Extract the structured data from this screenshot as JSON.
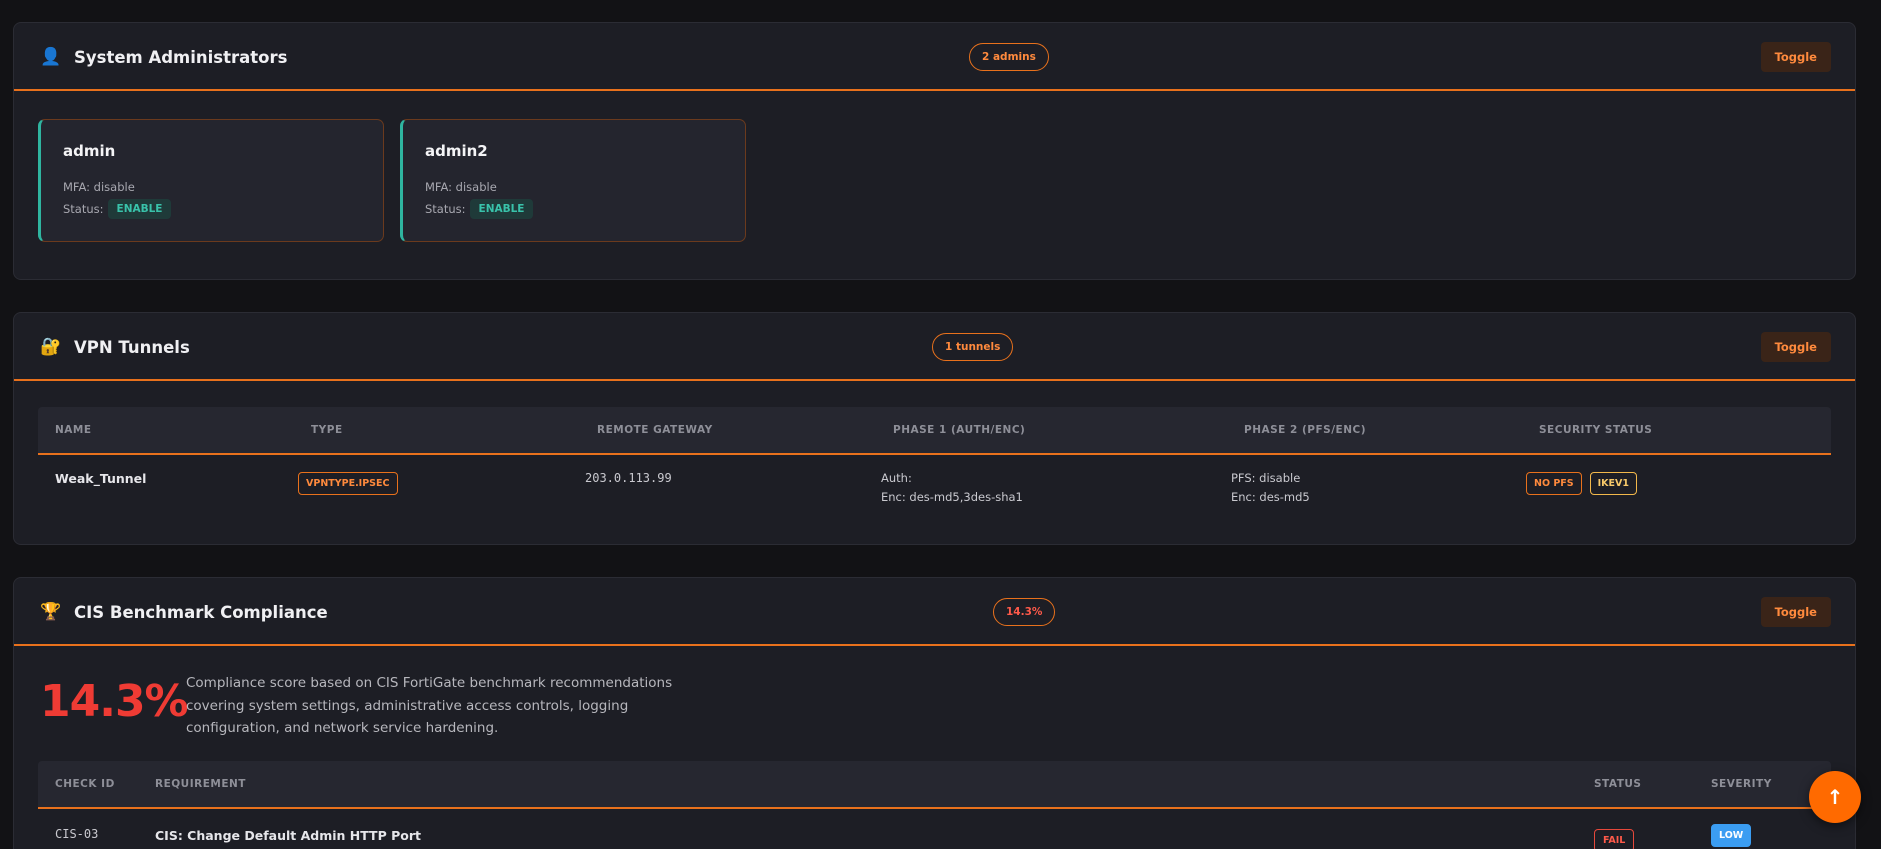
{
  "admins_section": {
    "icon": "person-icon",
    "icon_glyph": "👤",
    "title": "System Administrators",
    "count_badge": "2 admins",
    "toggle_label": "Toggle",
    "admins": [
      {
        "name": "admin",
        "mfa_label": "MFA: disable",
        "status_label": "Status:",
        "status": "ENABLE"
      },
      {
        "name": "admin2",
        "mfa_label": "MFA: disable",
        "status_label": "Status:",
        "status": "ENABLE"
      }
    ]
  },
  "vpn_section": {
    "icon": "lock-key-icon",
    "icon_glyph": "🔐",
    "title": "VPN Tunnels",
    "count_badge": "1 tunnels",
    "toggle_label": "Toggle",
    "columns": [
      "NAME",
      "TYPE",
      "REMOTE GATEWAY",
      "PHASE 1 (AUTH/ENC)",
      "PHASE 2 (PFS/ENC)",
      "SECURITY STATUS"
    ],
    "rows": [
      {
        "name": "Weak_Tunnel",
        "type": "VPNTYPE.IPSEC",
        "remote_gateway": "203.0.113.99",
        "phase1_auth": "Auth:",
        "phase1_enc": "Enc: des-md5,3des-sha1",
        "phase2_pfs": "PFS: disable",
        "phase2_enc": "Enc: des-md5",
        "security_tags": [
          "NO PFS",
          "IKEV1"
        ]
      }
    ]
  },
  "cis_section": {
    "icon": "trophy-icon",
    "icon_glyph": "🏆",
    "title": "CIS Benchmark Compliance",
    "score_badge": "14.3%",
    "toggle_label": "Toggle",
    "score": "14.3%",
    "description": "Compliance score based on CIS FortiGate benchmark recommendations covering system settings, administrative access controls, logging configuration, and network service hardening.",
    "columns": [
      "CHECK ID",
      "REQUIREMENT",
      "STATUS",
      "SEVERITY"
    ],
    "rows": [
      {
        "check_id": "CIS-03",
        "requirement": "CIS: Change Default Admin HTTP Port",
        "status": "FAIL",
        "severity": "LOW"
      }
    ]
  },
  "scroll_top_button": {
    "icon": "arrow-up-icon",
    "glyph": "↑"
  },
  "colors": {
    "accent": "#e8711c",
    "teal": "#2fb5a0",
    "danger": "#ef3b34",
    "info": "#3b9df2",
    "background": "#121215",
    "panel": "#1d1e25"
  }
}
